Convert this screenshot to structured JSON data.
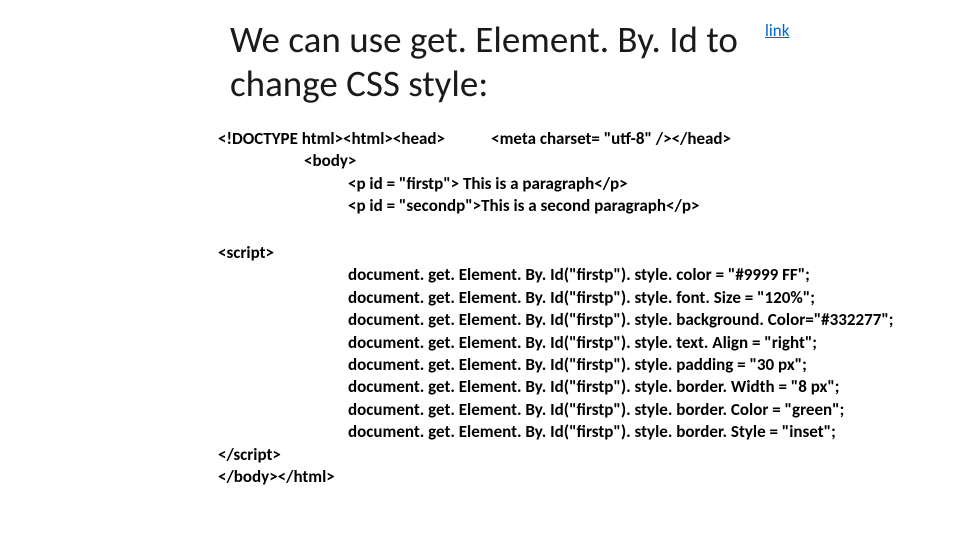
{
  "title": "We can use get. Element. By. Id to change CSS style:",
  "link_label": "link",
  "code": {
    "l1a": "<!DOCTYPE html><html><head>",
    "l1b": "<meta charset= \"utf-8\" /></head>",
    "l2": "<body>",
    "l3": "<p id = \"firstp\"> This is a paragraph</p>",
    "l4": "<p id = \"secondp\">This is a second paragraph</p>",
    "l5": "<script>",
    "l6": "document. get. Element. By. Id(\"firstp\"). style. color = \"#9999 FF\";",
    "l7": "document. get. Element. By. Id(\"firstp\"). style. font. Size = \"120%\";",
    "l8": "document. get. Element. By. Id(\"firstp\"). style. background. Color=\"#332277\";",
    "l9": "document. get. Element. By. Id(\"firstp\"). style. text. Align = \"right\";",
    "l10": "document. get. Element. By. Id(\"firstp\"). style. padding = \"30 px\";",
    "l11": "document. get. Element. By. Id(\"firstp\"). style. border. Width = \"8 px\";",
    "l12": "document. get. Element. By. Id(\"firstp\"). style. border. Color = \"green\";",
    "l13": "document. get. Element. By. Id(\"firstp\"). style. border. Style = \"inset\";",
    "l14": "</scr",
    "l14b": "ipt>",
    "l15": "</body></html>"
  }
}
